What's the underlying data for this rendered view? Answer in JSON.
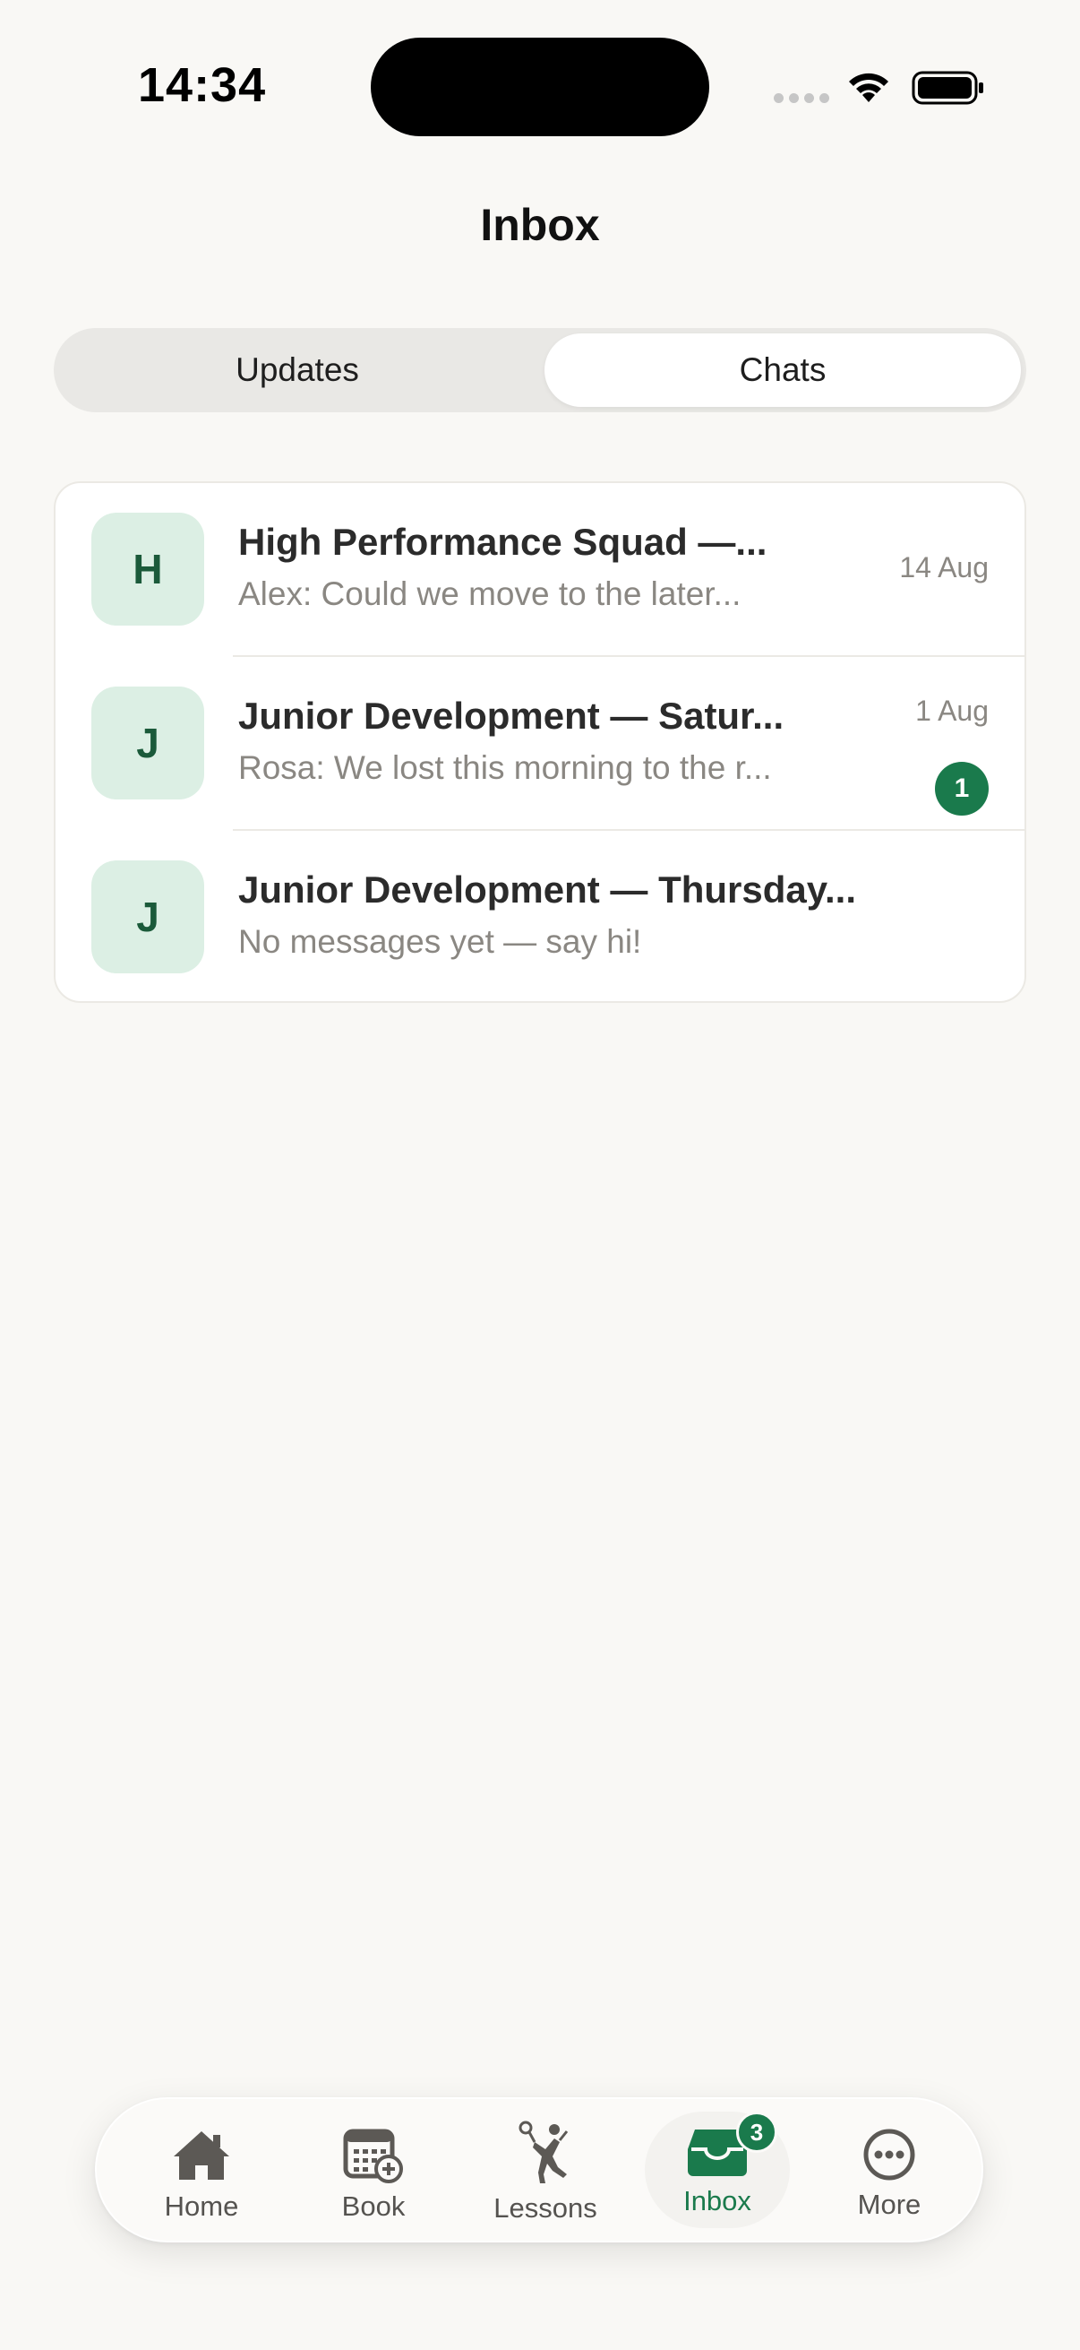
{
  "status_bar": {
    "time": "14:34"
  },
  "header": {
    "title": "Inbox"
  },
  "segments": {
    "updates": "Updates",
    "chats": "Chats",
    "selected": "Chats"
  },
  "chats": [
    {
      "avatar_letter": "H",
      "title": "High Performance Squad —...",
      "preview": "Alex: Could we move to the later...",
      "date": "14 Aug",
      "unread": null
    },
    {
      "avatar_letter": "J",
      "title": "Junior Development — Satur...",
      "preview": "Rosa: We lost this morning to the r...",
      "date": "1 Aug",
      "unread": "1"
    },
    {
      "avatar_letter": "J",
      "title": "Junior Development — Thursday...",
      "preview": "No messages yet — say hi!",
      "date": "",
      "unread": null
    }
  ],
  "tab_bar": {
    "active": "Inbox",
    "tabs": [
      {
        "label": "Home",
        "icon": "home-icon"
      },
      {
        "label": "Book",
        "icon": "calendar-add-icon"
      },
      {
        "label": "Lessons",
        "icon": "tennis-player-icon"
      },
      {
        "label": "Inbox",
        "icon": "inbox-tray-icon",
        "badge": "3"
      },
      {
        "label": "More",
        "icon": "more-circle-icon"
      }
    ]
  },
  "colors": {
    "accent": "#1a7a4c",
    "background": "#f9f8f5",
    "avatar_bg": "#dcefe4"
  }
}
